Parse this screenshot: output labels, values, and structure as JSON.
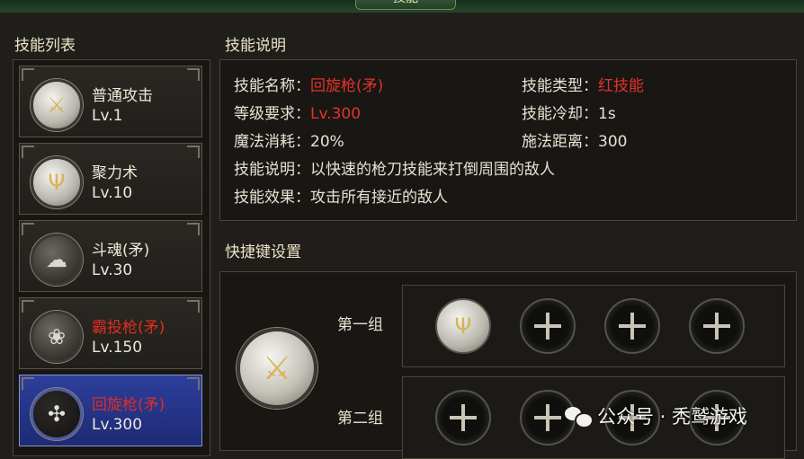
{
  "window": {
    "title": "技能"
  },
  "skill_list": {
    "title": "技能列表",
    "items": [
      {
        "name": "普通攻击",
        "level": "Lv.1",
        "icon": "sword-icon",
        "name_color": "default"
      },
      {
        "name": "聚力术",
        "level": "Lv.10",
        "icon": "power-icon",
        "name_color": "default"
      },
      {
        "name": "斗魂(矛)",
        "level": "Lv.30",
        "icon": "wind-icon",
        "name_color": "default"
      },
      {
        "name": "霸投枪(矛)",
        "level": "Lv.150",
        "icon": "lotus-icon",
        "name_color": "#e02d22"
      },
      {
        "name": "回旋枪(矛)",
        "level": "Lv.300",
        "icon": "spear-whirl-icon",
        "name_color": "#e02d22",
        "selected": true
      }
    ]
  },
  "skill_detail": {
    "title": "技能说明",
    "name_label": "技能名称：",
    "name_value": "回旋枪(矛)",
    "type_label": "技能类型：",
    "type_value": "红技能",
    "level_req_label": "等级要求：",
    "level_req_value": "Lv.300",
    "cooldown_label": "技能冷却：",
    "cooldown_value": "1s",
    "mana_label": "魔法消耗：",
    "mana_value": "20%",
    "range_label": "施法距离：",
    "range_value": "300",
    "desc_label": "技能说明：",
    "desc_value": "以快速的枪刀技能来打倒周围的敌人",
    "effect_label": "技能效果：",
    "effect_value": "攻击所有接近的敌人",
    "colors": {
      "highlight": "#e4322a"
    }
  },
  "shortcut": {
    "title": "快捷键设置",
    "current_skill_icon": "sword-icon",
    "groups": [
      {
        "label": "第一组",
        "slots": [
          "power-icon",
          "plus-icon",
          "plus-icon",
          "plus-icon"
        ]
      },
      {
        "label": "第二组",
        "slots": [
          "plus-icon",
          "plus-icon",
          "plus-icon",
          "plus-icon"
        ]
      }
    ]
  },
  "watermark": {
    "text": "公众号 · 秃鹫游戏"
  }
}
